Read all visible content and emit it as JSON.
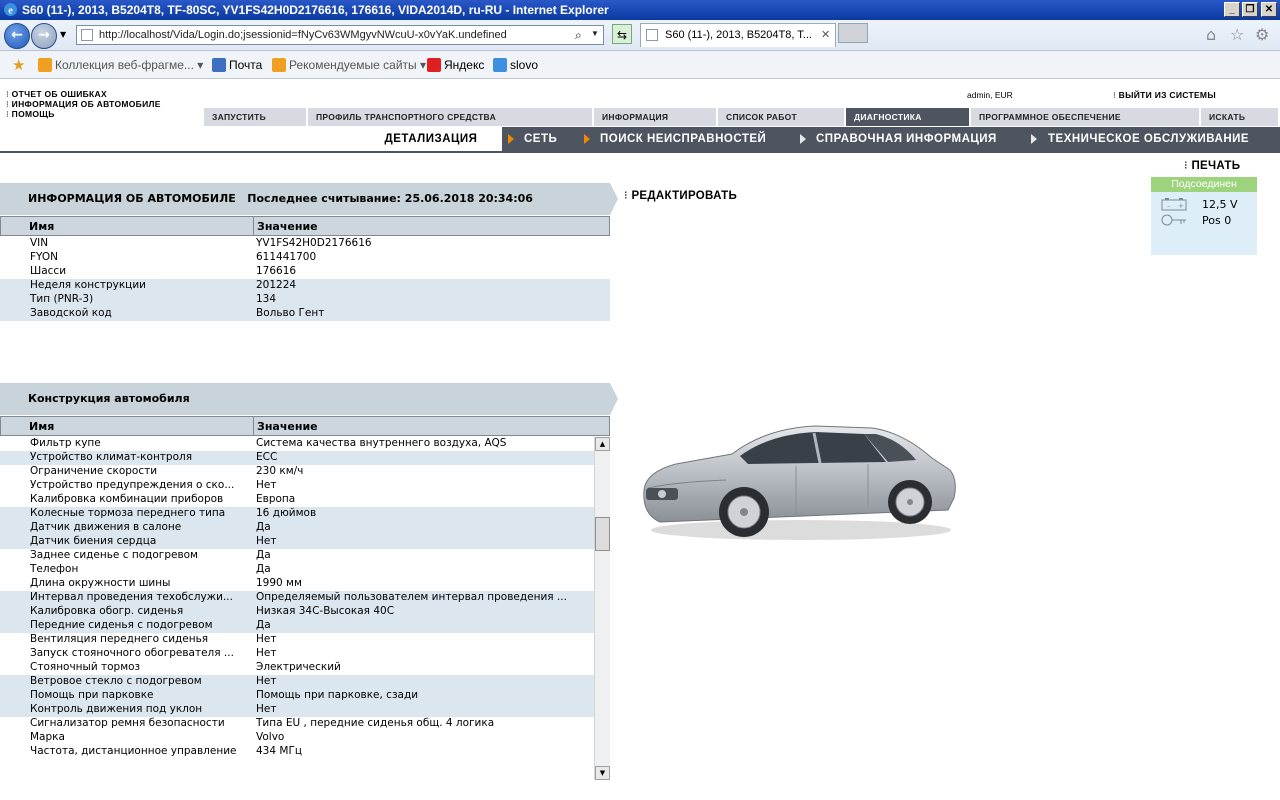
{
  "window": {
    "title": "S60 (11-), 2013, B5204T8, TF-80SC, YV1FS42H0D2176616, 176616, VIDA2014D, ru-RU - Internet Explorer"
  },
  "browser": {
    "url": "http://localhost/Vida/Login.do;jsessionid=fNyCv63WMgyvNWcuU-x0vYaK.undefined",
    "tab_title": "S60 (11-), 2013, B5204T8, T...",
    "favorites": [
      {
        "label": "Коллекция веб-фрагме...",
        "color": "#f0a020"
      },
      {
        "label": "Почта",
        "color": "#3d6fc0"
      },
      {
        "label": "Рекомендуемые сайты",
        "color": "#f0a020"
      },
      {
        "label": "Яндекс",
        "color": "#e02020"
      },
      {
        "label": "slovo",
        "color": "#3d8fe0"
      }
    ]
  },
  "header": {
    "links": [
      "ОТЧЕТ ОБ ОШИБКАХ",
      "ИНФОРМАЦИЯ ОБ АВТОМОБИЛЕ",
      "ПОМОЩЬ"
    ],
    "user": "admin, EUR",
    "logout": "ВЫЙТИ ИЗ СИСТЕМЫ"
  },
  "main_tabs": [
    "ЗАПУСТИТЬ",
    "ПРОФИЛЬ ТРАНСПОРТНОГО СРЕДСТВА",
    "ИНФОРМАЦИЯ",
    "СПИСОК РАБОТ",
    "ДИАГНОСТИКА",
    "ПРОГРАММНОЕ ОБЕСПЕЧЕНИЕ",
    "ИСКАТЬ"
  ],
  "sub_tabs": [
    "ДЕТАЛИЗАЦИЯ",
    "СЕТЬ",
    "ПОИСК НЕИСПРАВНОСТЕЙ",
    "СПРАВОЧНАЯ ИНФОРМАЦИЯ",
    "ТЕХНИЧЕСКОЕ ОБСЛУЖИВАНИЕ"
  ],
  "actions": {
    "print": "ПЕЧАТЬ",
    "edit": "РЕДАКТИРОВАТЬ"
  },
  "vehicle_info": {
    "title": "ИНФОРМАЦИЯ ОБ АВТОМОБИЛЕ",
    "last_read": "Последнее считывание: 25.06.2018 20:34:06",
    "col_name": "Имя",
    "col_value": "Значение",
    "rows": [
      [
        "VIN",
        "YV1FS42H0D2176616"
      ],
      [
        "FYON",
        "611441700"
      ],
      [
        "Шасси",
        "176616"
      ],
      [
        "Неделя конструкции",
        "201224"
      ],
      [
        "Тип (PNR-3)",
        "134"
      ],
      [
        "Заводской код",
        "Вольво Гент"
      ]
    ]
  },
  "construction": {
    "title": "Конструкция автомобиля",
    "col_name": "Имя",
    "col_value": "Значение",
    "rows": [
      [
        "Фильтр купе",
        "Система качества внутреннего воздуха, AQS"
      ],
      [
        "Устройство климат-контроля",
        "ECC"
      ],
      [
        "Ограничение скорости",
        "230 км/ч"
      ],
      [
        "Устройство предупреждения о ско...",
        "Нет"
      ],
      [
        "Калибровка комбинации приборов",
        "Европа"
      ],
      [
        "Колесные тормоза переднего типа",
        "16 дюймов"
      ],
      [
        "Датчик движения в салоне",
        "Да"
      ],
      [
        "Датчик биения сердца",
        "Нет"
      ],
      [
        "Заднее сиденье с подогревом",
        "Да"
      ],
      [
        "Телефон",
        "Да"
      ],
      [
        "Длина окружности шины",
        "1990 мм"
      ],
      [
        "Интервал проведения техобслужи...",
        "Определяемый пользователем интервал проведения ..."
      ],
      [
        "Калибровка обогр. сиденья",
        "Низкая 34С-Высокая 40С"
      ],
      [
        "Передние сиденья с подогревом",
        "Да"
      ],
      [
        "Вентиляция переднего сиденья",
        "Нет"
      ],
      [
        "Запуск стояночного обогревателя ...",
        "Нет"
      ],
      [
        "Стояночный тормоз",
        "Электрический"
      ],
      [
        "Ветровое стекло с подогревом",
        "Нет"
      ],
      [
        "Помощь при парковке",
        "Помощь при парковке, сзади"
      ],
      [
        "Контроль движения под уклон",
        "Нет"
      ],
      [
        "Сигнализатор ремня безопасности",
        "Типа EU , передние сиденья общ. 4 логика"
      ],
      [
        "Марка",
        "Volvo"
      ],
      [
        "Частота, дистанционное управление",
        "434 МГц"
      ]
    ]
  },
  "connection": {
    "status": "Подсоединен",
    "voltage": "12,5 V",
    "pos": "Pos 0",
    "status_color": "#9ed37e"
  }
}
